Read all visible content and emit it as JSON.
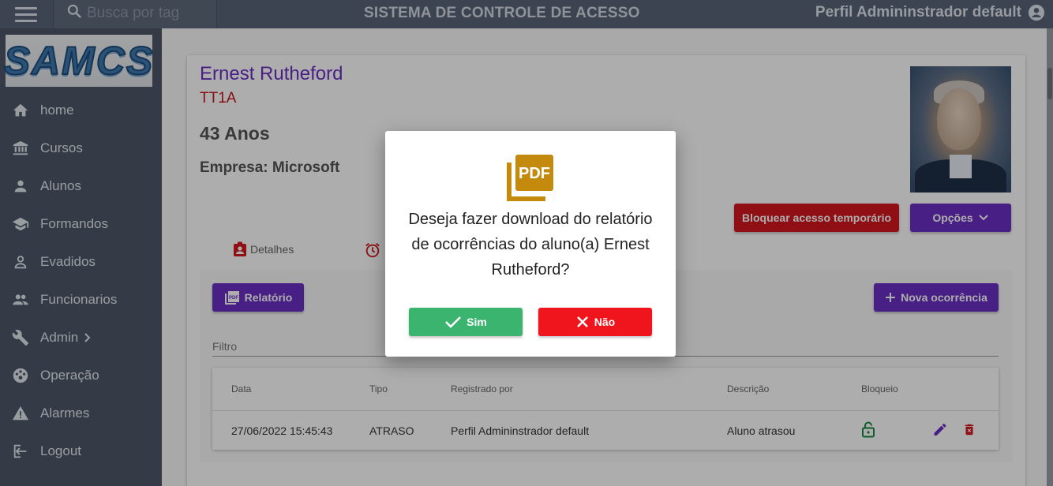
{
  "header": {
    "search_placeholder": "Busca por tag",
    "title": "SISTEMA DE CONTROLE DE ACESSO",
    "profile_name": "Perfil Admininstrador default"
  },
  "sidebar": {
    "logo_text": "SAMCS",
    "items": [
      {
        "label": "home",
        "icon": "home-icon"
      },
      {
        "label": "Cursos",
        "icon": "bank-icon"
      },
      {
        "label": "Alunos",
        "icon": "person-icon"
      },
      {
        "label": "Formandos",
        "icon": "graduation-cap-icon"
      },
      {
        "label": "Evadidos",
        "icon": "person-outline-icon"
      },
      {
        "label": "Funcionarios",
        "icon": "people-icon"
      },
      {
        "label": "Admin",
        "icon": "wrench-icon"
      },
      {
        "label": "Operação",
        "icon": "dashboard-icon"
      },
      {
        "label": "Alarmes",
        "icon": "warning-icon"
      },
      {
        "label": "Logout",
        "icon": "logout-icon"
      }
    ]
  },
  "student": {
    "name": "Ernest Rutheford",
    "class": "TT1A",
    "age": "43 Anos",
    "company": "Empresa: Microsoft"
  },
  "actions": {
    "block_label": "Bloquear acesso temporário",
    "options_label": "Opções"
  },
  "tabs": [
    {
      "label": "Detalhes",
      "icon": "badge-icon"
    },
    {
      "label": "",
      "icon": "alarm-clock-icon"
    }
  ],
  "panel": {
    "report_label": "Relatório",
    "new_label": "Nova ocorrência",
    "filter_placeholder": "Filtro"
  },
  "table": {
    "headers": [
      "Data",
      "Tipo",
      "Registrado por",
      "Descrição",
      "Bloqueio"
    ],
    "rows": [
      {
        "data": "27/06/2022 15:45:43",
        "tipo": "ATRASO",
        "registrado_por": "Perfil Admininstrador default",
        "descricao": "Aluno atrasou",
        "bloqueio": "unlocked"
      }
    ]
  },
  "dialog": {
    "icon_text": "PDF",
    "message": "Deseja fazer download do relatório de ocorrências do aluno(a) Ernest Rutheford?",
    "confirm_label": "Sim",
    "cancel_label": "Não"
  },
  "colors": {
    "topbar": "#5a6578",
    "sidebar": "#4d5869",
    "purple": "#6a2fc4",
    "red": "#d3171f",
    "green": "#3ab46e",
    "pdf_gold": "#c38a0e"
  }
}
